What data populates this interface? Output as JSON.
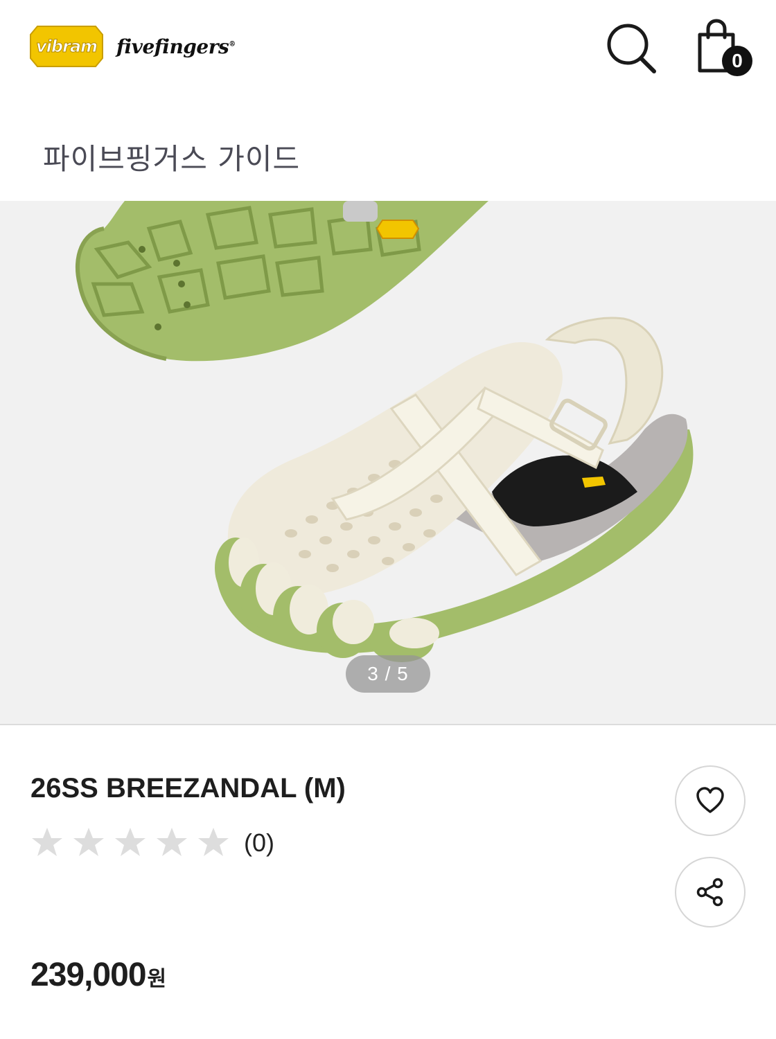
{
  "header": {
    "brand_badge": "vibram",
    "brand_name": "fivefingers",
    "brand_mark": "®",
    "search_icon": "search-icon",
    "cart_icon": "shopping-bag-icon",
    "cart_count": "0"
  },
  "guide": {
    "label": "파이브핑거스 가이드"
  },
  "gallery": {
    "pager": "3 / 5",
    "current": 3,
    "total": 5
  },
  "product": {
    "title": "26SS BREEZANDAL (M)",
    "rating_stars": 0,
    "rating_max": 5,
    "review_count": "(0)",
    "price": "239,000",
    "price_unit": "원",
    "wishlist_icon": "heart-icon",
    "share_icon": "share-icon"
  },
  "colors": {
    "brand_yellow": "#f2c500",
    "sole_green": "#a3bd6a",
    "shoe_cream": "#f0ecdc",
    "star_empty": "#dddddd"
  }
}
